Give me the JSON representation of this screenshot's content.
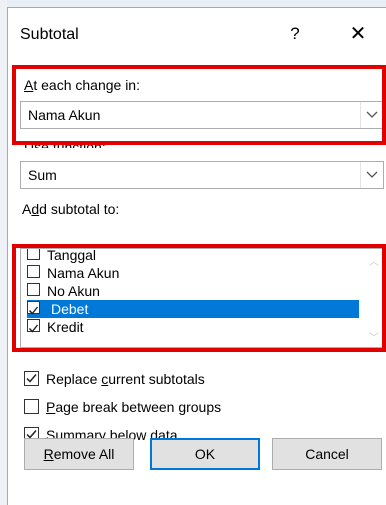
{
  "dialog": {
    "title": "Subtotal",
    "help_label": "?",
    "close_label": "✕"
  },
  "change_in": {
    "label_prefix": "",
    "label_accel": "A",
    "label_rest": "t each change in:",
    "value": "Nama Akun"
  },
  "use_function": {
    "label_accel": "U",
    "label_rest": "se function:",
    "value": "Sum"
  },
  "add_subtotal": {
    "label_pre": "A",
    "label_accel": "d",
    "label_rest": "d subtotal to:",
    "items": [
      {
        "label": "Tanggal",
        "checked": false,
        "selected": false
      },
      {
        "label": "Nama Akun",
        "checked": false,
        "selected": false
      },
      {
        "label": "No Akun",
        "checked": false,
        "selected": false
      },
      {
        "label": "Debet",
        "checked": true,
        "selected": true
      },
      {
        "label": "Kredit",
        "checked": true,
        "selected": false
      }
    ]
  },
  "options": {
    "replace": {
      "pre": "Replace ",
      "accel": "c",
      "rest": "urrent subtotals",
      "checked": true
    },
    "page_break": {
      "pre": "",
      "accel": "P",
      "rest": "age break between groups",
      "checked": false
    },
    "summary": {
      "pre": "",
      "accel": "S",
      "rest": "ummary below data",
      "checked": true
    }
  },
  "buttons": {
    "remove_all_accel": "R",
    "remove_all_rest": "emove All",
    "ok": "OK",
    "cancel": "Cancel"
  },
  "colors": {
    "highlight": "#e00000",
    "selection": "#0078d7"
  }
}
